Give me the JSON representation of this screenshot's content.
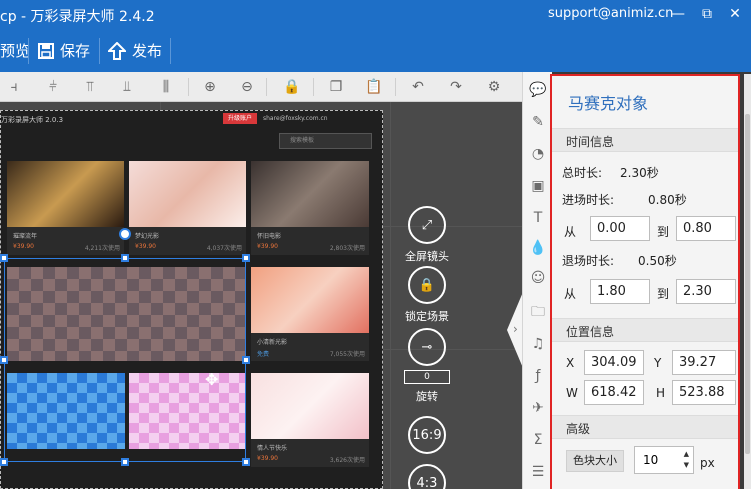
{
  "titlebar": {
    "title": "cp - 万彩录屏大师 2.4.2",
    "email": "support@animiz.cn",
    "minimize": "—",
    "restore": "⧉",
    "close": "✕"
  },
  "mainbar": {
    "preview": "预览",
    "save": "保存",
    "publish": "发布"
  },
  "canvas": {
    "screenshot": {
      "title": "万彩录屏大师 2.0.3",
      "tag": "升级账户",
      "mail": "share@foxsky.com.cn",
      "search_placeholder": "搜索模板",
      "tiles": [
        {
          "cap": "璀璨流年",
          "price": "¥39.90",
          "uses": "4,211次使用"
        },
        {
          "cap": "梦幻光影",
          "price": "¥39.90",
          "uses": "4,037次使用"
        },
        {
          "cap": "怀旧电影",
          "price": "¥39.90",
          "uses": "2,803次使用"
        },
        {
          "cap": "",
          "price": "",
          "uses": ""
        },
        {
          "cap": "小清新光影",
          "price": "免费",
          "uses": "7,055次使用"
        },
        {
          "cap": "",
          "price": "",
          "uses": ""
        },
        {
          "cap": "情人节快乐",
          "price": "¥39.90",
          "uses": "3,626次使用"
        }
      ]
    },
    "right_controls": {
      "fullscreen": "全屏镜头",
      "lock_scene": "锁定场景",
      "rotate_value": "0",
      "rotate": "旋转",
      "ratio_169": "16:9",
      "ratio_43": "4:3"
    }
  },
  "panel": {
    "title": "马赛克对象",
    "time_section": "时间信息",
    "total_label": "总时长:",
    "total_value": "2.30秒",
    "enter_label": "进场时长:",
    "enter_value": "0.80秒",
    "from": "从",
    "to": "到",
    "enter_from": "0.00",
    "enter_to": "0.80",
    "exit_label": "退场时长:",
    "exit_value": "0.50秒",
    "exit_from": "1.80",
    "exit_to": "2.30",
    "pos_section": "位置信息",
    "x_label": "X",
    "x_value": "304.09",
    "y_label": "Y",
    "y_value": "39.27",
    "w_label": "W",
    "w_value": "618.42",
    "h_label": "H",
    "h_value": "523.88",
    "adv_section": "高级",
    "block_size": "色块大小",
    "block_value": "10",
    "unit": "px"
  },
  "colors": {
    "brand_blue": "#1e6fc7",
    "highlight_red": "#e02424",
    "selection_blue": "#2f7ee0"
  }
}
